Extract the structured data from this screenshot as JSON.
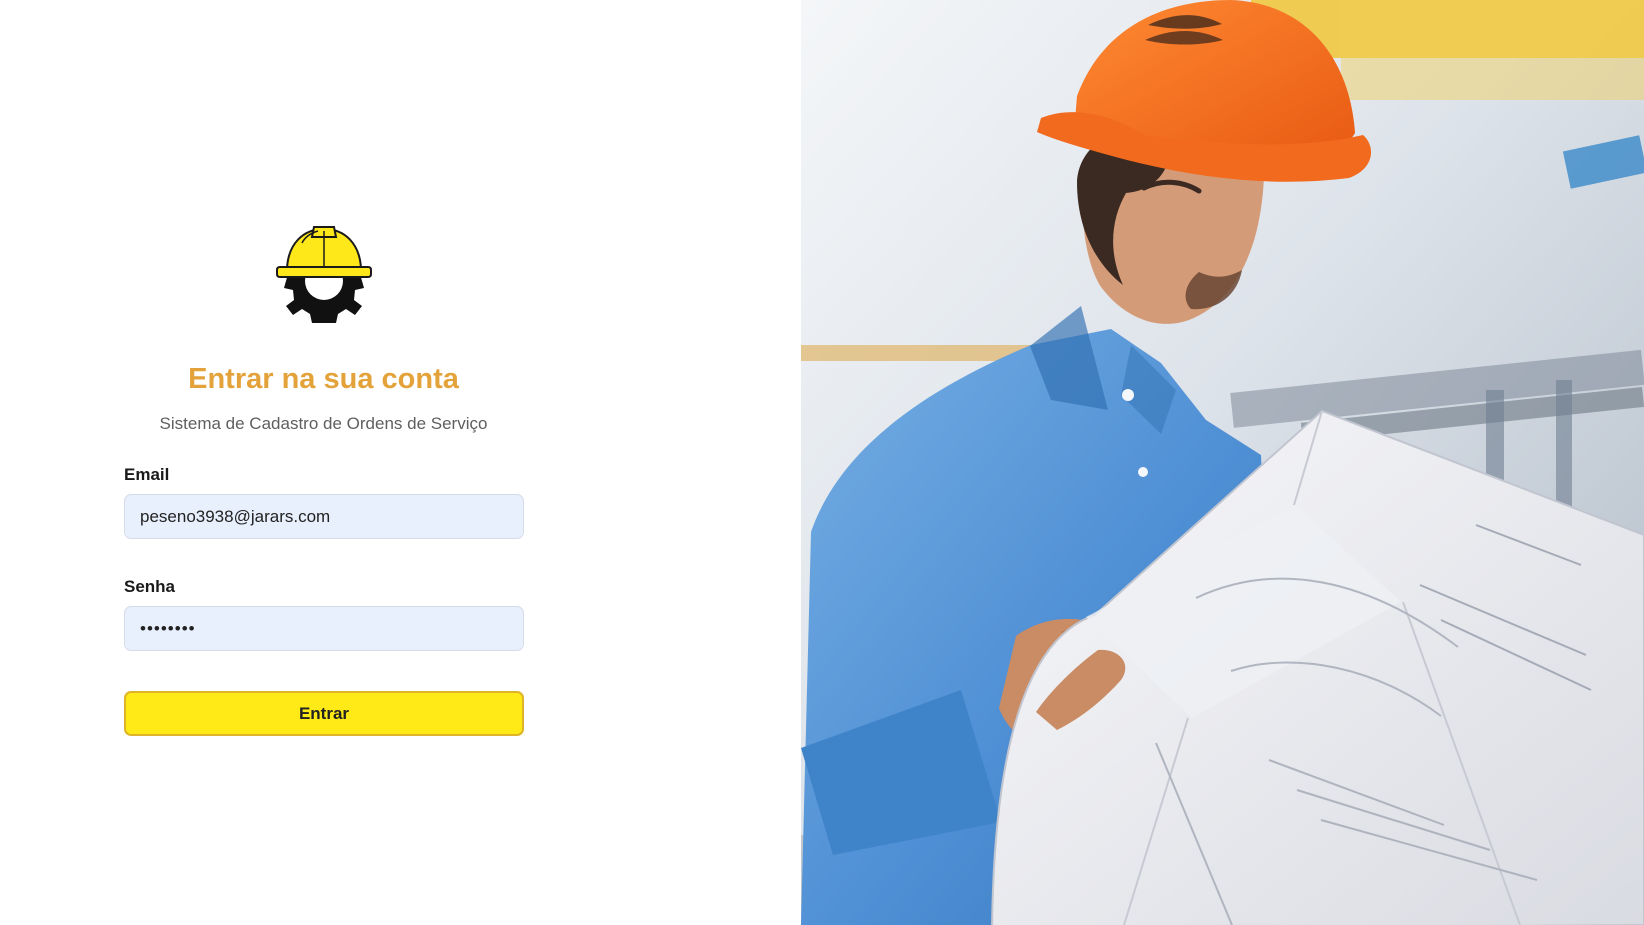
{
  "login": {
    "title": "Entrar na sua conta",
    "subtitle": "Sistema de Cadastro de Ordens de Serviço",
    "email_label": "Email",
    "email_value": "peseno3938@jarars.com",
    "password_label": "Senha",
    "password_value": "12345678",
    "submit_label": "Entrar"
  },
  "logo": {
    "icon": "hardhat-gear-icon",
    "helmet_color": "#ffe81a",
    "gear_color": "#111111"
  },
  "hero": {
    "icon": "engineer-photo",
    "hardhat_color": "#f26a1d",
    "shirt_color": "#4f8fd4"
  },
  "colors": {
    "title": "#e4a33a",
    "input_background": "#e8effd",
    "button_background": "#ffea17",
    "button_border": "#e0b428"
  }
}
